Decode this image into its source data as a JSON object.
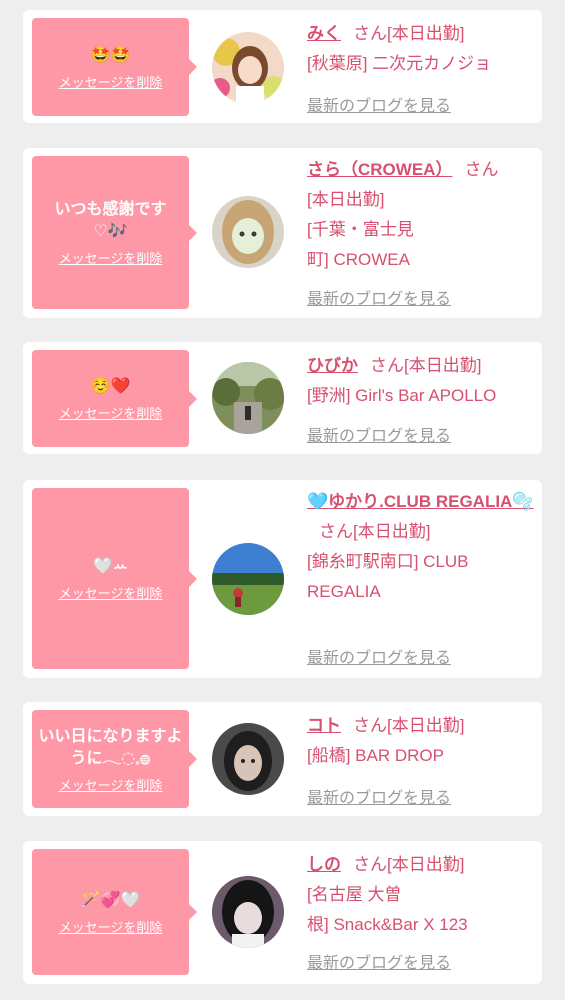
{
  "labels": {
    "delete": "メッセージを削除",
    "blog": "最新のブログを見る",
    "san": "さん"
  },
  "cards": [
    {
      "message": "🤩🤩",
      "name": "みく",
      "status": "[本日出勤]",
      "shop_line1": "[秋葉原] 二次元カノジョ",
      "shop_line2": ""
    },
    {
      "message": "いつも感謝です♡🎶",
      "name": "さら（CROWEA）",
      "status": "[本日出勤]",
      "shop_line1": "[千葉・富士見",
      "shop_line2": "町] CROWEA"
    },
    {
      "message": "☺️❤️",
      "name": "ひびか",
      "status": "[本日出勤]",
      "shop_line1": "[野洲] Girl's Bar APOLLO",
      "shop_line2": ""
    },
    {
      "message": "🤍ꕀ",
      "name": "🩵ゆかり.CLUB REGALIA🫧",
      "status": "[本日出勤]",
      "shop_line1": "[錦糸町駅南口] CLUB",
      "shop_line2": "REGALIA"
    },
    {
      "message": "いい日になりますように𓂃◌𓈒𓐍",
      "name": "コト",
      "status": "[本日出勤]",
      "shop_line1": "[船橋] BAR DROP",
      "shop_line2": ""
    },
    {
      "message": "🪄💞🤍",
      "name": "しの",
      "status": "[本日出勤]",
      "shop_line1": "[名古屋 大曽",
      "shop_line2": "根] Snack&Bar X 123"
    }
  ],
  "colors": {
    "bubble": "#fe98a7",
    "accent": "#d7506f",
    "link_gray": "#9a9a9a",
    "background": "#eeeeee"
  }
}
